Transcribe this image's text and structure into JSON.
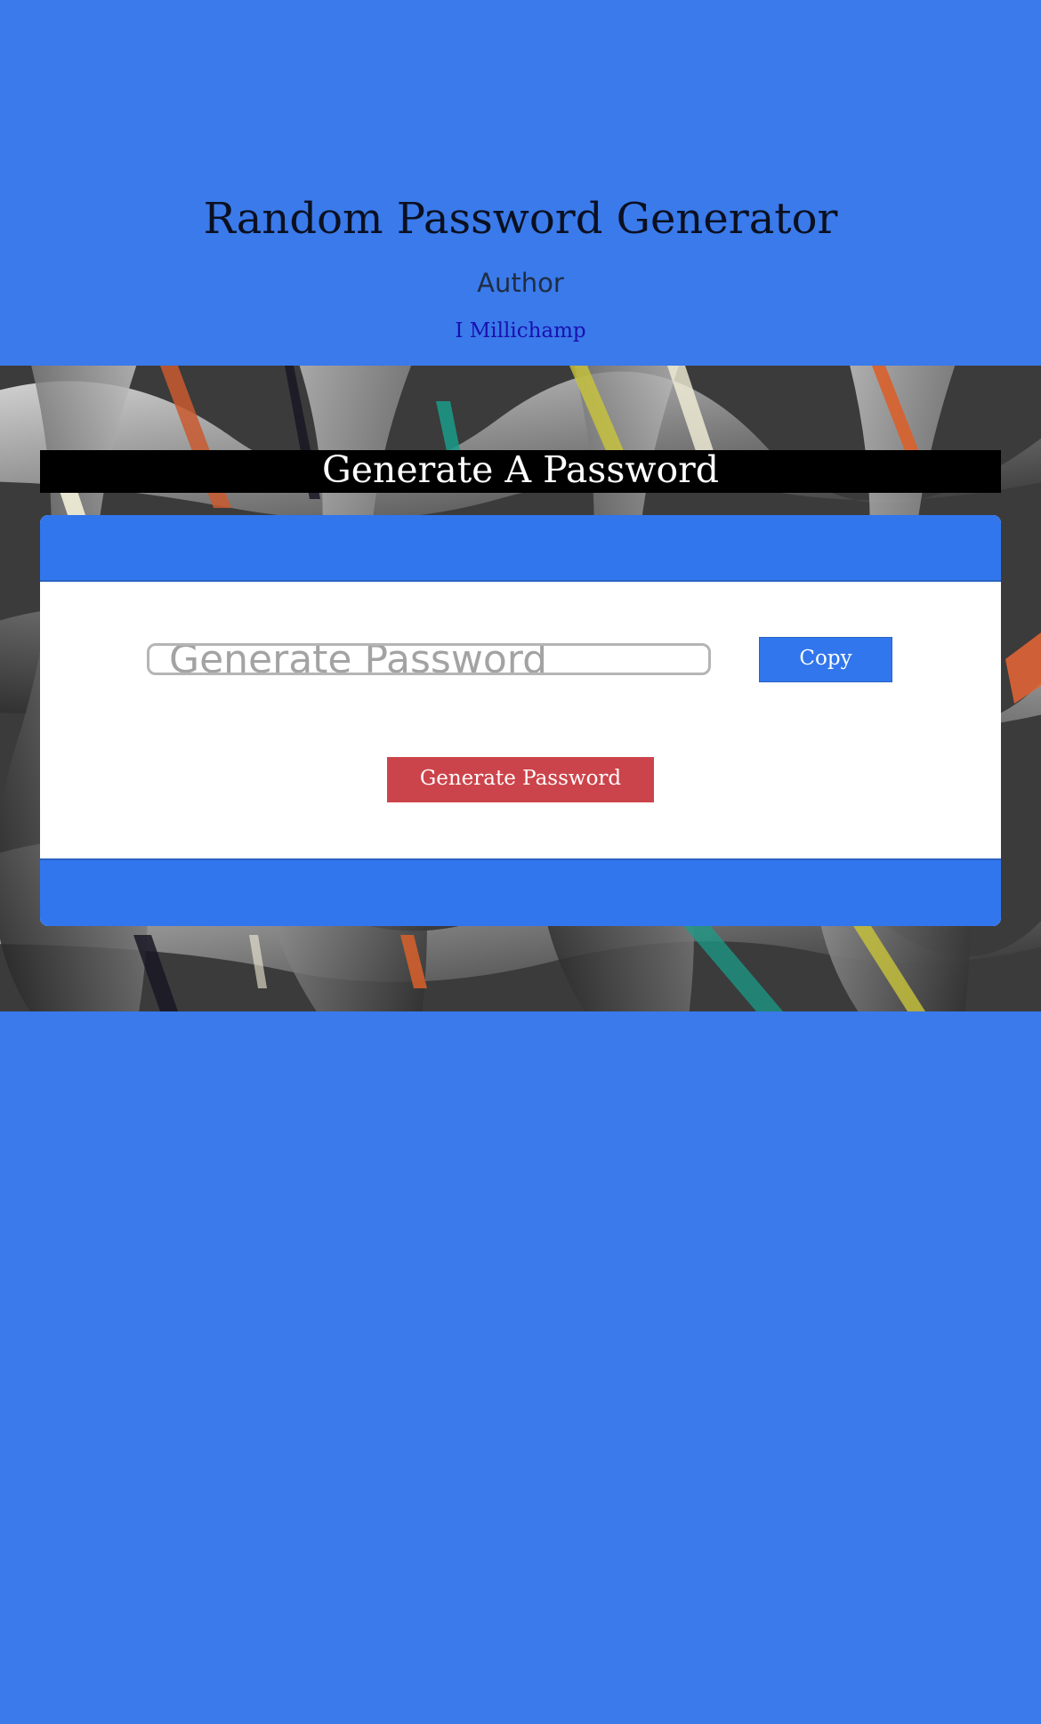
{
  "header": {
    "title": "Random Password Generator",
    "author_label": "Author",
    "author_name": "I Millichamp"
  },
  "panel": {
    "heading": "Generate A Password"
  },
  "password": {
    "value": "",
    "placeholder": "Generate Password"
  },
  "buttons": {
    "copy_label": "Copy",
    "generate_label": "Generate Password"
  },
  "colors": {
    "page_background": "#3a7aea",
    "card_header": "#3176ec",
    "generate_button": "#cc444b",
    "heading_band": "#000000"
  },
  "icons": {
    "hero_background": "abstract-woven-ribbons-image"
  }
}
